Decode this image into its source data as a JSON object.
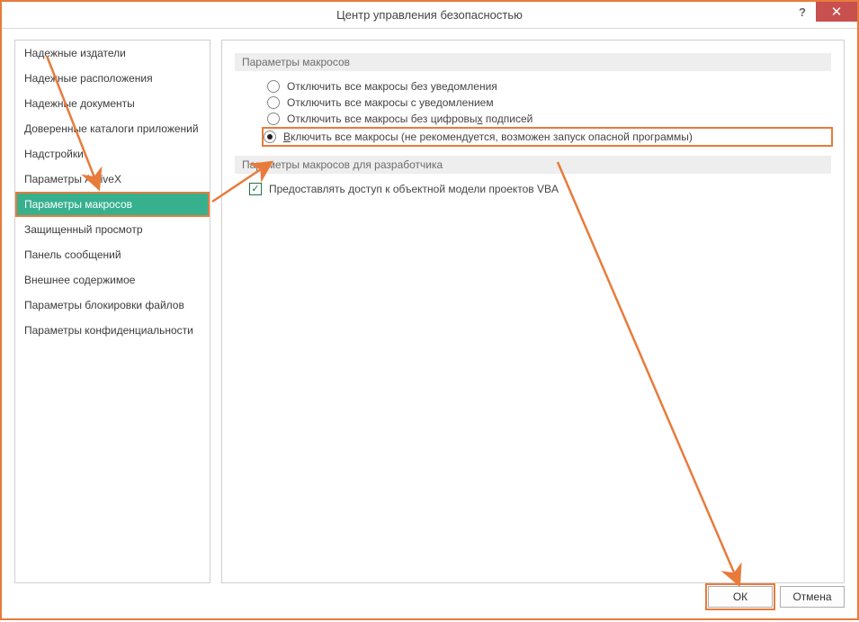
{
  "window": {
    "title": "Центр управления безопасностью"
  },
  "sidebar": {
    "items": [
      {
        "label": "Надежные издатели"
      },
      {
        "label": "Надежные расположения"
      },
      {
        "label": "Надежные документы"
      },
      {
        "label": "Доверенные каталоги приложений"
      },
      {
        "label": "Надстройки"
      },
      {
        "label": "Параметры ActiveX"
      },
      {
        "label": "Параметры макросов"
      },
      {
        "label": "Защищенный просмотр"
      },
      {
        "label": "Панель сообщений"
      },
      {
        "label": "Внешнее содержимое"
      },
      {
        "label": "Параметры блокировки файлов"
      },
      {
        "label": "Параметры конфиденциальности"
      }
    ],
    "selected_index": 6
  },
  "main": {
    "group1_title": "Параметры макросов",
    "radios": [
      {
        "label": "Отключить все макросы без уведомления",
        "checked": false,
        "hotkey_index": 29
      },
      {
        "label": "Отключить все макросы с уведомлением",
        "checked": false,
        "hotkey_index": 27
      },
      {
        "label": "Отключить все макросы без цифровых подписей",
        "checked": false,
        "hotkey_index": 33
      },
      {
        "label": "Включить все макросы (не рекомендуется, возможен запуск опасной программы)",
        "checked": true,
        "hotkey_index": 0
      }
    ],
    "group2_title": "Параметры макросов для разработчика",
    "checkbox": {
      "label": "Предоставлять доступ к объектной модели проектов VBA",
      "checked": true,
      "hotkey_index": 26
    }
  },
  "footer": {
    "ok": "ОК",
    "cancel": "Отмена"
  }
}
